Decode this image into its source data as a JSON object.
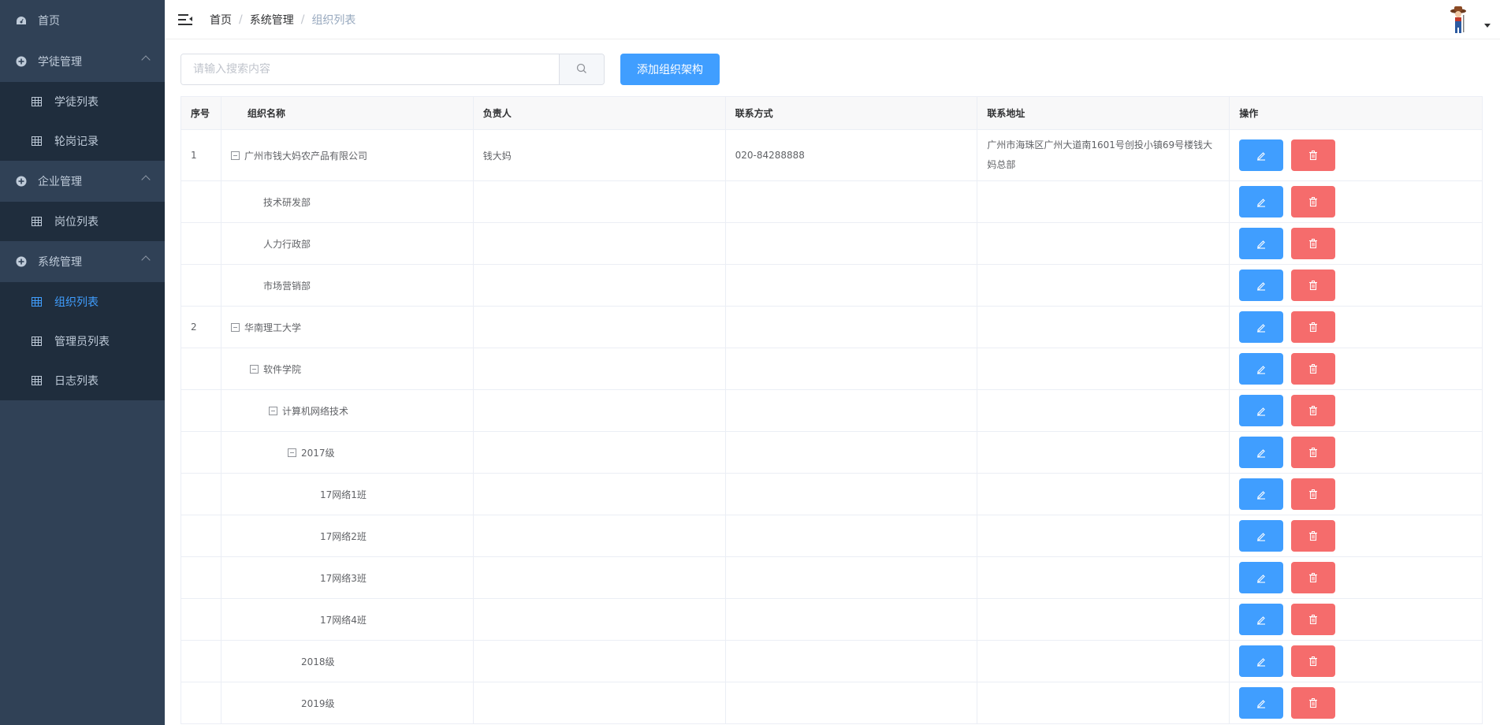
{
  "sidebar": {
    "home": "首页",
    "groups": [
      {
        "label": "学徒管理",
        "items": [
          "学徒列表",
          "轮岗记录"
        ]
      },
      {
        "label": "企业管理",
        "items": [
          "岗位列表"
        ]
      },
      {
        "label": "系统管理",
        "items": [
          "组织列表",
          "管理员列表",
          "日志列表"
        ]
      }
    ],
    "active_item": "组织列表"
  },
  "navbar": {
    "breadcrumb": [
      "首页",
      "系统管理",
      "组织列表"
    ],
    "separator": "/"
  },
  "toolbar": {
    "search_placeholder": "请输入搜索内容",
    "add_label": "添加组织架构"
  },
  "table": {
    "headers": [
      "序号",
      "组织名称",
      "负责人",
      "联系方式",
      "联系地址",
      "操作"
    ],
    "rows": [
      {
        "index": "1",
        "name": "广州市钱大妈农产品有限公司",
        "level": 0,
        "expandable": true,
        "owner": "钱大妈",
        "phone": "020-84288888",
        "address": "广州市海珠区广州大道南1601号创投小镇69号楼钱大妈总部"
      },
      {
        "index": "",
        "name": "技术研发部",
        "level": 1,
        "expandable": false,
        "owner": "",
        "phone": "",
        "address": ""
      },
      {
        "index": "",
        "name": "人力行政部",
        "level": 1,
        "expandable": false,
        "owner": "",
        "phone": "",
        "address": ""
      },
      {
        "index": "",
        "name": "市场营销部",
        "level": 1,
        "expandable": false,
        "owner": "",
        "phone": "",
        "address": ""
      },
      {
        "index": "2",
        "name": "华南理工大学",
        "level": 0,
        "expandable": true,
        "owner": "",
        "phone": "",
        "address": ""
      },
      {
        "index": "",
        "name": "软件学院",
        "level": 1,
        "expandable": true,
        "owner": "",
        "phone": "",
        "address": ""
      },
      {
        "index": "",
        "name": "计算机网络技术",
        "level": 2,
        "expandable": true,
        "owner": "",
        "phone": "",
        "address": ""
      },
      {
        "index": "",
        "name": "2017级",
        "level": 3,
        "expandable": true,
        "owner": "",
        "phone": "",
        "address": ""
      },
      {
        "index": "",
        "name": "17网络1班",
        "level": 4,
        "expandable": false,
        "owner": "",
        "phone": "",
        "address": ""
      },
      {
        "index": "",
        "name": "17网络2班",
        "level": 4,
        "expandable": false,
        "owner": "",
        "phone": "",
        "address": ""
      },
      {
        "index": "",
        "name": "17网络3班",
        "level": 4,
        "expandable": false,
        "owner": "",
        "phone": "",
        "address": ""
      },
      {
        "index": "",
        "name": "17网络4班",
        "level": 4,
        "expandable": false,
        "owner": "",
        "phone": "",
        "address": ""
      },
      {
        "index": "",
        "name": "2018级",
        "level": 3,
        "expandable": false,
        "owner": "",
        "phone": "",
        "address": ""
      },
      {
        "index": "",
        "name": "2019级",
        "level": 3,
        "expandable": false,
        "owner": "",
        "phone": "",
        "address": ""
      }
    ]
  },
  "colors": {
    "sidebar_bg": "#304156",
    "submenu_bg": "#1f2d3d",
    "accent": "#409eff",
    "danger": "#f56c6c"
  },
  "icons": {
    "home": "dashboard-icon",
    "group": "plus-circle-icon",
    "item": "table-grid-icon",
    "search": "search-icon",
    "edit": "edit-icon",
    "delete": "trash-icon"
  }
}
